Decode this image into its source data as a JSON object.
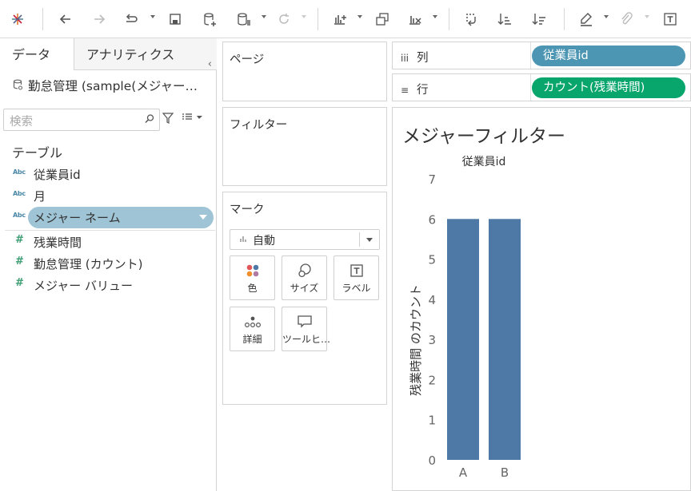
{
  "toolbar": {
    "icons": [
      "tableau-logo-icon",
      "undo-icon",
      "redo-icon",
      "replay-icon",
      "save-icon",
      "new-datasource-icon",
      "pause-updates-icon",
      "refresh-icon",
      "new-worksheet-icon",
      "duplicate-icon",
      "clear-sheet-icon",
      "swap-icon",
      "sort-ascending-icon",
      "sort-descending-icon",
      "highlight-icon",
      "group-icon",
      "show-labels-icon"
    ]
  },
  "left_panel": {
    "tabs": {
      "data": "データ",
      "analytics": "アナリティクス"
    },
    "collapse": "‹",
    "datasource": "勤怠管理 (sample(メジャー…",
    "search_placeholder": "検索",
    "section_tables": "テーブル",
    "fields": [
      {
        "type": "Abc",
        "label": "従業員id"
      },
      {
        "type": "Abc",
        "label": "月"
      },
      {
        "type": "Abc",
        "label": "メジャー ネーム"
      },
      {
        "type": "#",
        "label": "残業時間"
      },
      {
        "type": "#",
        "label": "勤怠管理 (カウント)"
      },
      {
        "type": "#",
        "label": "メジャー バリュー"
      }
    ]
  },
  "cards": {
    "pages": "ページ",
    "filters": "フィルター",
    "marks": "マーク",
    "mark_type": "自動",
    "buttons": {
      "color": "色",
      "size": "サイズ",
      "label": "ラベル",
      "detail": "詳細",
      "tooltip": "ツールヒ…"
    }
  },
  "shelves": {
    "columns": {
      "icon": "iii",
      "label": "列",
      "pill": "従業員id"
    },
    "rows": {
      "icon": "≡",
      "label": "行",
      "pill": "カウント(残業時間)"
    }
  },
  "sheet": {
    "title": "メジャーフィルター"
  },
  "chart_data": {
    "type": "bar",
    "header": "従業員id",
    "categories": [
      "A",
      "B"
    ],
    "values": [
      6,
      6
    ],
    "ylabel": "残業時間 のカウント",
    "ylim": [
      0,
      7
    ],
    "yticks": [
      0,
      1,
      2,
      3,
      4,
      5,
      6,
      7
    ],
    "bar_color": "#4e79a7",
    "grid": false
  },
  "colors": {
    "blue_pill": "#4d96b3",
    "green_pill": "#08a56c",
    "selected_field": "#9ec4d6"
  }
}
